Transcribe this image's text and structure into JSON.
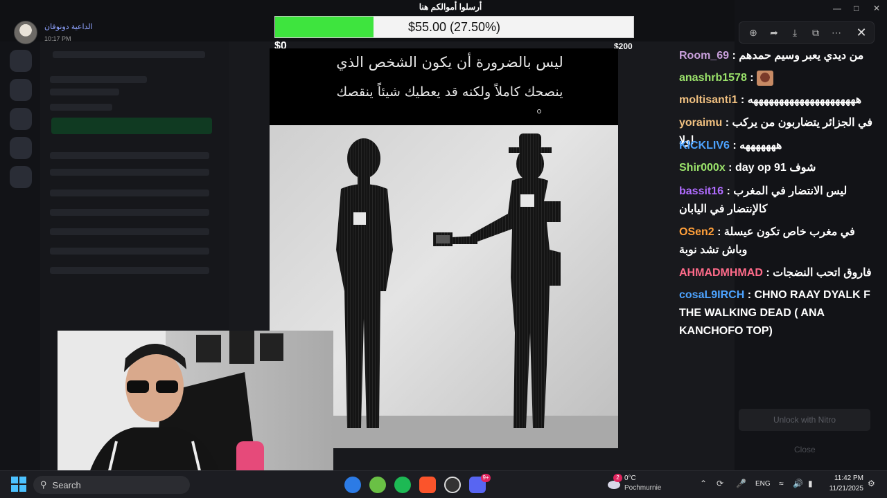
{
  "discord": {
    "user": {
      "name": "الداعية دونوفان",
      "time": "10:17 PM"
    },
    "toolbar_icons": [
      "zoom-in-icon",
      "forward-icon",
      "download-icon",
      "open-external-icon",
      "more-icon"
    ],
    "close_icon": "close-icon",
    "nitro_button": "Unlock with Nitro",
    "close_label": "Close"
  },
  "donation": {
    "title": "أرسلوا أموالكم هنا",
    "amount_text": "$55.00 (27.50%)",
    "progress": 0.275,
    "min_label": "$0",
    "max_label": "$200",
    "fill_color": "#3ee43e"
  },
  "quote": {
    "line1": "ليس بالضرورة أن يكون الشخص الذي",
    "line2": "ينصحك كاملاً ولكنه قد يعطيك شيئاً ينقصك"
  },
  "chat": {
    "messages": [
      {
        "user": "Room_69",
        "color": "#c9a0dc",
        "text": "من ديدي يعبر وسيم حمدهم"
      },
      {
        "user": "anashrb1578",
        "color": "#9be36b",
        "text": "",
        "emote": "emote-face"
      },
      {
        "user": "moltisanti1",
        "color": "#f0c080",
        "text": "هههههههههههههههههههههه"
      },
      {
        "user": "yoraimu",
        "color": "#f0c080",
        "text": "في الجزائر يتضاربون من يركب اولا"
      },
      {
        "user": "KICKLIV6",
        "color": "#4da3ff",
        "text": "هههههههه"
      },
      {
        "user": "Shir000x",
        "color": "#9be36b",
        "text": "شوف 91 day op"
      },
      {
        "user": "bassit16",
        "color": "#b06cff",
        "text": "ليس الانتضار في المغرب كالإنتضار في اليابان"
      },
      {
        "user": "OSen2",
        "color": "#ff9f3a",
        "text": "في مغرب خاص تكون عيسلة وباش تشد نوبة"
      },
      {
        "user": "AHMADMHMAD",
        "color": "#ff6b8a",
        "text": "فاروق اتحب النضجات"
      },
      {
        "user": "cosaL9IRCH",
        "color": "#4da3ff",
        "text": "CHNO RAAY DYALK F THE WALKING DEAD ( ANA KANCHOFO TOP)"
      }
    ]
  },
  "taskbar": {
    "search_placeholder": "Search",
    "weather": {
      "temp": "0°C",
      "desc": "Pochmurnie",
      "badge": "2"
    },
    "language": "ENG",
    "time": "11:42 PM",
    "date": "11/21/2025",
    "discord_badge": "9+",
    "apps": [
      "windows-start-icon",
      "search-icon",
      "file-explorer-icon",
      "whatsapp-icon",
      "firefox-icon",
      "chrome-icon",
      "brave-icon",
      "onenote-icon",
      "vlc-icon",
      "utorrent-icon",
      "spotify-icon",
      "brave-browser-icon",
      "obs-icon",
      "discord-icon"
    ]
  }
}
